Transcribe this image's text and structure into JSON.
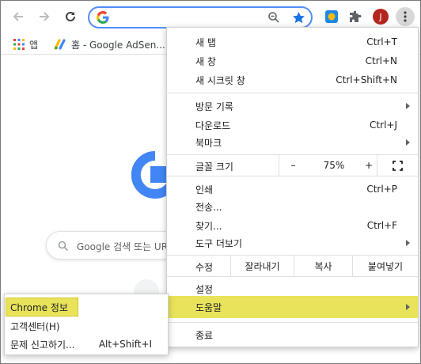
{
  "toolbar": {
    "back_icon": "arrow-left-icon",
    "forward_icon": "arrow-right-icon",
    "reload_icon": "reload-icon",
    "avatar_initial": "J"
  },
  "bookmarks": {
    "apps_label": "앱",
    "adsense_label": "홈 - Google AdSen..."
  },
  "page": {
    "search_placeholder": "Google 검색 또는 UR"
  },
  "menu": {
    "new_tab": {
      "label": "새 탭",
      "shortcut": "Ctrl+T"
    },
    "new_window": {
      "label": "새 창",
      "shortcut": "Ctrl+N"
    },
    "incognito": {
      "label": "새 시크릿 창",
      "shortcut": "Ctrl+Shift+N"
    },
    "history": {
      "label": "방문 기록"
    },
    "downloads": {
      "label": "다운로드",
      "shortcut": "Ctrl+J"
    },
    "bookmarks": {
      "label": "북마크"
    },
    "zoom": {
      "label": "글꼴 크기",
      "minus": "–",
      "value": "75%",
      "plus": "+"
    },
    "print": {
      "label": "인쇄",
      "shortcut": "Ctrl+P"
    },
    "cast": {
      "label": "전송..."
    },
    "find": {
      "label": "찾기...",
      "shortcut": "Ctrl+F"
    },
    "more_tools": {
      "label": "도구 더보기"
    },
    "edit": {
      "label": "수정",
      "cut": "잘라내기",
      "copy": "복사",
      "paste": "붙여넣기"
    },
    "settings": {
      "label": "설정"
    },
    "help": {
      "label": "도움말"
    },
    "exit": {
      "label": "종료"
    }
  },
  "help_submenu": {
    "about": {
      "label": "Chrome 정보"
    },
    "help_center": {
      "label": "고객센터(H)"
    },
    "report": {
      "label": "문제 신고하기...",
      "shortcut": "Alt+Shift+I"
    }
  },
  "colors": {
    "highlight": "#e8e35a",
    "omnibox_border": "#4f8ef7",
    "avatar": "#b3261e"
  }
}
